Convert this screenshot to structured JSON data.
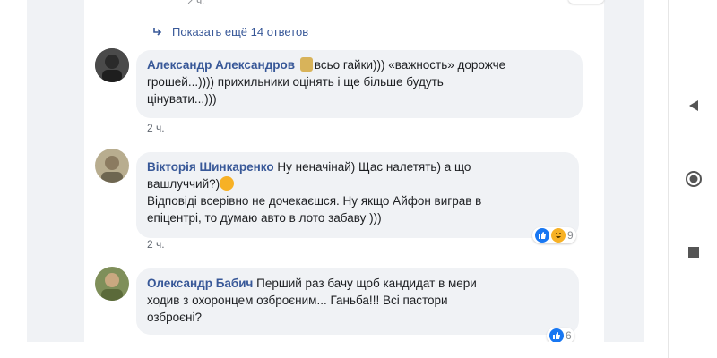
{
  "thread": {
    "top_timestamp": "2 ч.",
    "show_more_replies": "Показать ещё 14 ответов"
  },
  "comments": [
    {
      "author": "Александр Александров",
      "text_line1": "всьо гайки))) «важность» дорожче",
      "text_line2": "грошей...)))) прихильники оцінять і ще більше будуть",
      "text_line3": "цінувати...)))",
      "timestamp": "2 ч."
    },
    {
      "author": "Вікторія Шинкаренко",
      "text_line1": "Ну неначінай) Щас налетять) а що",
      "text_line2": "вашлуччий?)",
      "text_line3": "Відповіді всерівно не дочекаєшся. Ну якщо Айфон виграв в",
      "text_line4": "епіцентрі, то думаю авто в лото забаву )))",
      "timestamp": "2 ч.",
      "reaction_count": "9",
      "reaction_icons": [
        "like-icon",
        "haha-icon"
      ]
    },
    {
      "author": "Олександр Бабич",
      "text_line1": "Перший раз бачу щоб кандидат в мери",
      "text_line2": "ходив з охоронцем озброєним... Ганьба!!! Всі пастори",
      "text_line3": "озброєні?",
      "reaction_count": "6",
      "reaction_icons": [
        "like-icon"
      ]
    }
  ],
  "colors": {
    "author": "#385898",
    "bubble": "#f0f2f5",
    "feed_bg": "#f0f2f5",
    "like": "#1877f2",
    "haha": "#f7b125"
  },
  "system_nav": {
    "icons": [
      "back-icon",
      "home-icon",
      "recents-icon"
    ]
  }
}
